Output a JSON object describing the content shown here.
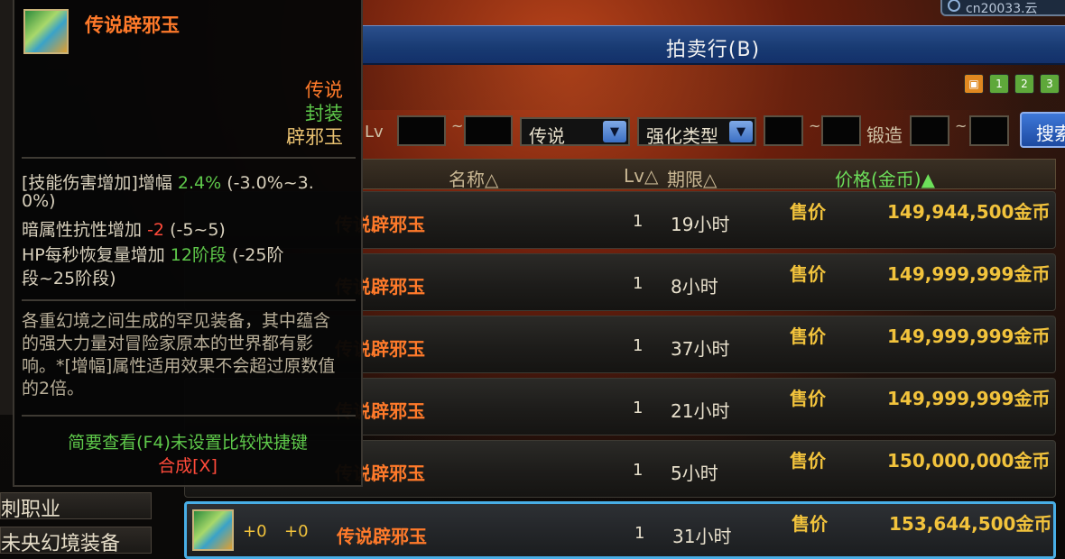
{
  "server": {
    "label": "cn20033.云"
  },
  "window": {
    "title": "拍卖行(B)"
  },
  "toolbar_icons": [
    "1",
    "2",
    "3"
  ],
  "filters": {
    "lv_label": "Lv",
    "tilde": "~",
    "rarity": "传说",
    "enhance_type": "强化类型",
    "forge_label": "锻造",
    "search": "搜索"
  },
  "table": {
    "headers": {
      "name": "名称△",
      "lv": "Lv△",
      "period": "期限△",
      "price": "价格(金币)▲"
    },
    "rows": [
      {
        "name": "传说辟邪玉",
        "lv": "1",
        "duration": "19小时",
        "sale": "售价",
        "price": "149,944,500金币"
      },
      {
        "name": "传说辟邪玉",
        "lv": "1",
        "duration": "8小时",
        "sale": "售价",
        "price": "149,999,999金币"
      },
      {
        "name": "传说辟邪玉",
        "lv": "1",
        "duration": "37小时",
        "sale": "售价",
        "price": "149,999,999金币"
      },
      {
        "name": "传说辟邪玉",
        "lv": "1",
        "duration": "21小时",
        "sale": "售价",
        "price": "149,999,999金币"
      },
      {
        "name": "传说辟邪玉",
        "lv": "1",
        "duration": "5小时",
        "sale": "售价",
        "price": "150,000,000金币"
      },
      {
        "name": "传说辟邪玉",
        "lv": "1",
        "duration": "31小时",
        "sale": "售价",
        "price": "153,644,500金币",
        "plus1": "+0",
        "plus2": "+0"
      }
    ]
  },
  "sidebar": {
    "item1": "刺职业",
    "item2": "未央幻境装备"
  },
  "tooltip": {
    "name": "传说辟邪玉",
    "rarity": "传说",
    "seal": "封装",
    "type": "辟邪玉",
    "stat1_prefix": "[技能伤害增加]增幅",
    "stat1_value": "2.4%",
    "stat1_range": "(-3.0%~3.",
    "stat1_range2": "0%)",
    "stat2_prefix": "暗属性抗性增加",
    "stat2_value": "-2",
    "stat2_range": "(-5~5)",
    "stat3_prefix": "HP每秒恢复量增加",
    "stat3_value": "12阶段",
    "stat3_range": "(-25阶",
    "stat3_range2": "段~25阶段)",
    "description": "各重幻境之间生成的罕见装备，其中蕴含的强大力量对冒险家原本的世界都有影响。*[增幅]属性适用效果不会超过原数值的2倍。",
    "hint": "简要查看(F4)未设置比较快捷键",
    "synth": "合成[X]"
  }
}
